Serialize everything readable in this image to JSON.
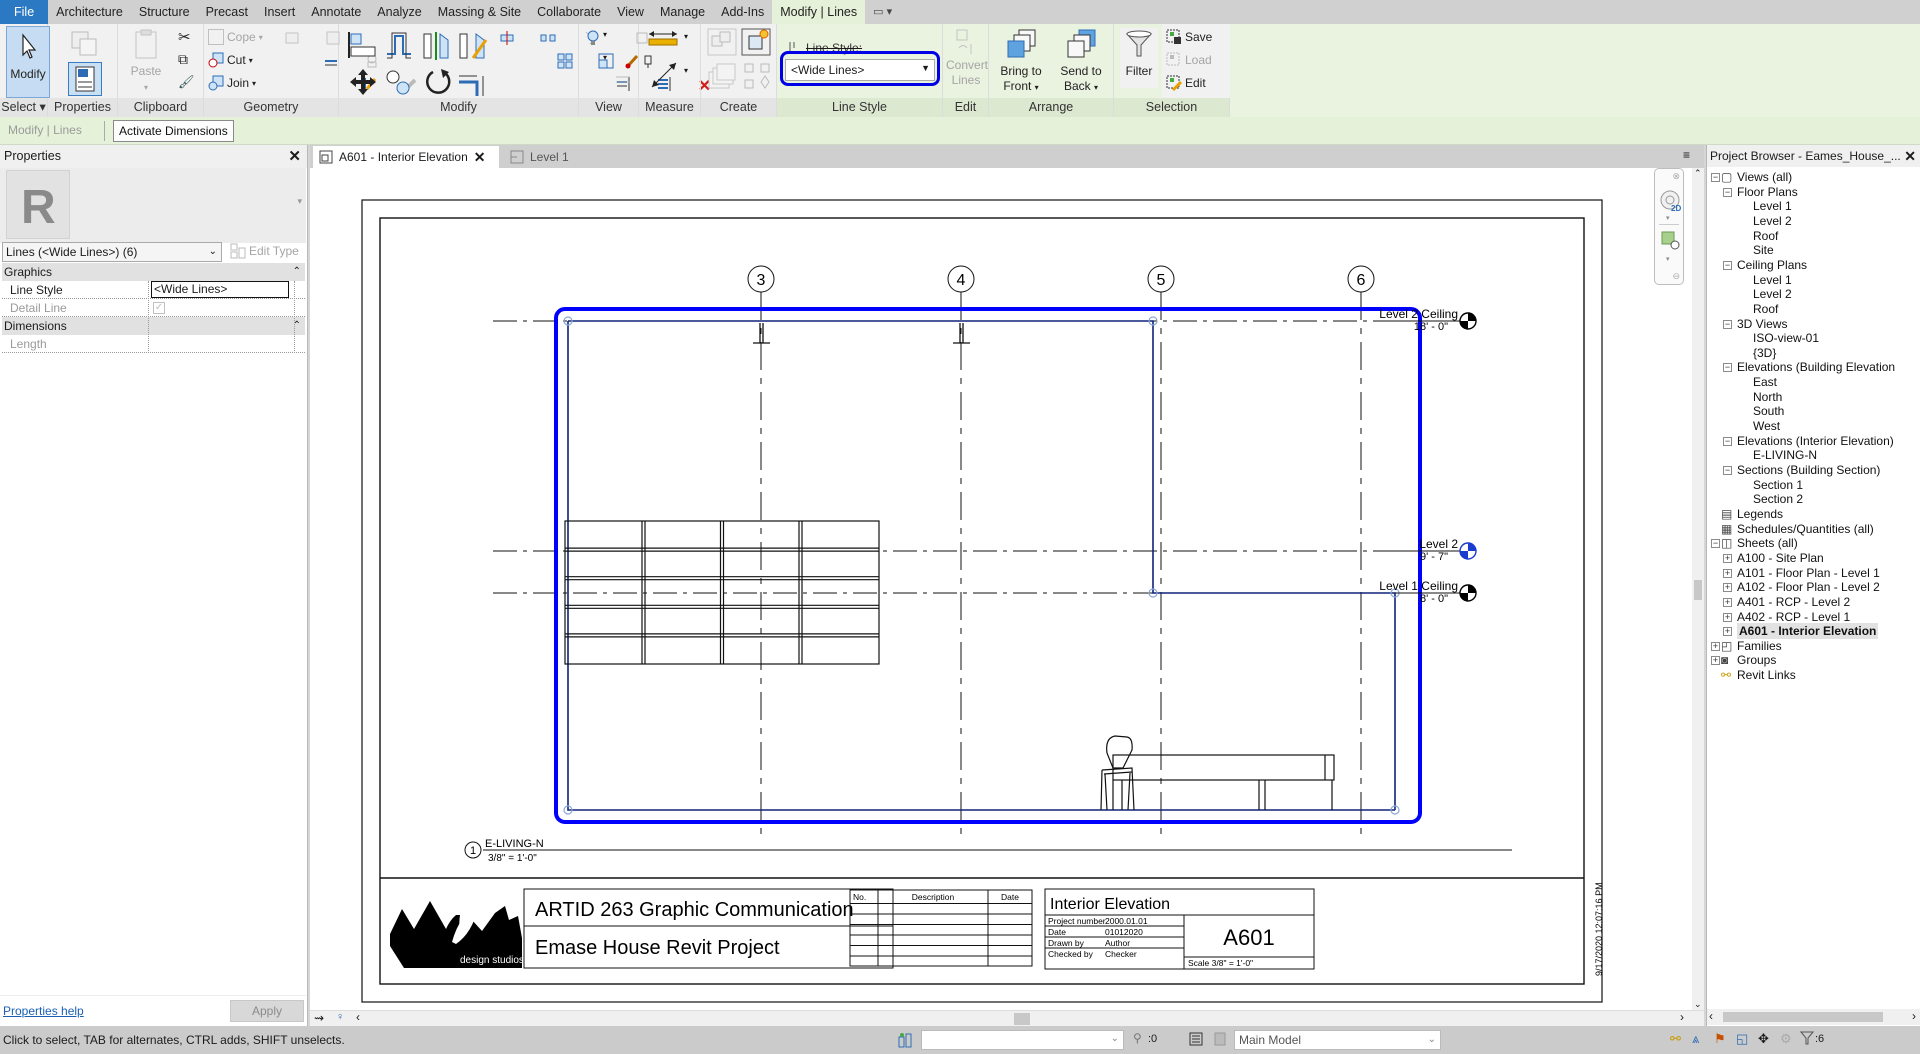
{
  "menu_tabs": [
    {
      "label": "File",
      "style": "file"
    },
    {
      "label": "Architecture"
    },
    {
      "label": "Structure"
    },
    {
      "label": "Precast"
    },
    {
      "label": "Insert"
    },
    {
      "label": "Annotate"
    },
    {
      "label": "Analyze"
    },
    {
      "label": "Massing & Site"
    },
    {
      "label": "Collaborate"
    },
    {
      "label": "View"
    },
    {
      "label": "Manage"
    },
    {
      "label": "Add-Ins"
    },
    {
      "label": "Modify | Lines",
      "style": "ctx"
    }
  ],
  "qat_label": "▭ ▾",
  "ribbon": {
    "select": {
      "modify": "Modify",
      "label": "Select ▾"
    },
    "properties": {
      "label": "Properties"
    },
    "clipboard": {
      "paste": "Paste",
      "label": "Clipboard"
    },
    "geometry": {
      "cope": "Cope",
      "cut": "Cut",
      "join": "Join",
      "label": "Geometry"
    },
    "modify": {
      "label": "Modify"
    },
    "view": {
      "label": "View"
    },
    "measure": {
      "label": "Measure"
    },
    "create": {
      "label": "Create"
    },
    "line_style": {
      "title": "Line Style:",
      "value": "<Wide Lines>",
      "label": "Line Style"
    },
    "edit": {
      "convert": "Convert",
      "lines": "Lines",
      "label": "Edit"
    },
    "arrange": {
      "bring1": "Bring to",
      "bring2": "Front",
      "send1": "Send to",
      "send2": "Back",
      "label": "Arrange"
    },
    "selection": {
      "filter": "Filter",
      "save": "Save",
      "load": "Load",
      "edit": "Edit",
      "label": "Selection"
    }
  },
  "options_bar": {
    "context": "Modify | Lines",
    "activate": "Activate Dimensions"
  },
  "properties": {
    "title": "Properties",
    "type_selector": "Lines (<Wide Lines>) (6)",
    "edit_type": "Edit Type",
    "groups": [
      {
        "name": "Graphics",
        "rows": [
          {
            "label": "Line Style",
            "value": "<Wide Lines>"
          },
          {
            "label": "Detail Line",
            "value": "checked"
          }
        ]
      },
      {
        "name": "Dimensions",
        "rows": [
          {
            "label": "Length",
            "value": ""
          }
        ]
      }
    ],
    "help": "Properties help",
    "apply": "Apply"
  },
  "view_tabs": [
    {
      "label": "A601 - Interior Elevation",
      "active": true
    },
    {
      "label": "Level 1",
      "active": false
    }
  ],
  "sheet": {
    "grids": [
      "3",
      "4",
      "5",
      "6"
    ],
    "levels": [
      {
        "name": "Level 2 Ceiling",
        "elev": "18' - 0\""
      },
      {
        "name": "Level 2",
        "elev": "9' - 7\""
      },
      {
        "name": "Level 1 Ceiling",
        "elev": "8' - 0\""
      }
    ],
    "view_number": "1",
    "view_name": "E-LIVING-N",
    "view_scale": "3/8\" = 1'-0\"",
    "logo_text": "design   studios",
    "course": "ARTID 263 Graphic Communication",
    "project": "Emase House Revit Project",
    "revision_headers": [
      "No.",
      "Description",
      "Date"
    ],
    "sheet_name": "Interior Elevation",
    "info": [
      {
        "label": "Project number",
        "value": "2000.01.01"
      },
      {
        "label": "Date",
        "value": "01012020"
      },
      {
        "label": "Drawn by",
        "value": "Author"
      },
      {
        "label": "Checked by",
        "value": "Checker"
      }
    ],
    "sheet_number": "A601",
    "scale": "Scale  3/8\" = 1'-0\"",
    "timestamp": "9/17/2020 12:07:16 PM"
  },
  "browser": {
    "title": "Project Browser - Eames_House_...",
    "items": [
      {
        "label": "Views (all)",
        "level": 0,
        "exp": "-",
        "icon": "views"
      },
      {
        "label": "Floor Plans",
        "level": 1,
        "exp": "-"
      },
      {
        "label": "Level 1",
        "level": 2
      },
      {
        "label": "Level 2",
        "level": 2
      },
      {
        "label": "Roof",
        "level": 2
      },
      {
        "label": "Site",
        "level": 2
      },
      {
        "label": "Ceiling Plans",
        "level": 1,
        "exp": "-"
      },
      {
        "label": "Level 1",
        "level": 2
      },
      {
        "label": "Level 2",
        "level": 2
      },
      {
        "label": "Roof",
        "level": 2
      },
      {
        "label": "3D Views",
        "level": 1,
        "exp": "-"
      },
      {
        "label": "ISO-view-01",
        "level": 2
      },
      {
        "label": "{3D}",
        "level": 2
      },
      {
        "label": "Elevations (Building Elevation",
        "level": 1,
        "exp": "-"
      },
      {
        "label": "East",
        "level": 2
      },
      {
        "label": "North",
        "level": 2
      },
      {
        "label": "South",
        "level": 2
      },
      {
        "label": "West",
        "level": 2
      },
      {
        "label": "Elevations (Interior Elevation)",
        "level": 1,
        "exp": "-"
      },
      {
        "label": "E-LIVING-N",
        "level": 2
      },
      {
        "label": "Sections (Building Section)",
        "level": 1,
        "exp": "-"
      },
      {
        "label": "Section 1",
        "level": 2
      },
      {
        "label": "Section 2",
        "level": 2
      },
      {
        "label": "Legends",
        "level": 0,
        "icon": "legend"
      },
      {
        "label": "Schedules/Quantities (all)",
        "level": 0,
        "icon": "schedule"
      },
      {
        "label": "Sheets (all)",
        "level": 0,
        "exp": "-",
        "icon": "sheet"
      },
      {
        "label": "A100 - Site Plan",
        "level": 1,
        "exp": "+"
      },
      {
        "label": "A101 - Floor Plan - Level 1",
        "level": 1,
        "exp": "+"
      },
      {
        "label": "A102 - Floor Plan - Level 2",
        "level": 1,
        "exp": "+"
      },
      {
        "label": "A401 - RCP - Level 2",
        "level": 1,
        "exp": "+"
      },
      {
        "label": "A402 - RCP - Level 1",
        "level": 1,
        "exp": "+"
      },
      {
        "label": "A601 - Interior Elevation",
        "level": 1,
        "exp": "+",
        "selected": true
      },
      {
        "label": "Families",
        "level": 0,
        "exp": "+",
        "icon": "family"
      },
      {
        "label": "Groups",
        "level": 0,
        "exp": "+",
        "icon": "group"
      },
      {
        "label": "Revit Links",
        "level": 0,
        "icon": "link"
      }
    ]
  },
  "status": {
    "message": "Click to select, TAB for alternates, CTRL adds, SHIFT unselects.",
    "worksets": ":0",
    "model": "Main Model",
    "filter_count": ":6"
  },
  "colors": {
    "accent": "#2b79c2",
    "selection": "#0000ff",
    "context_tab": "#e6f1d9"
  }
}
